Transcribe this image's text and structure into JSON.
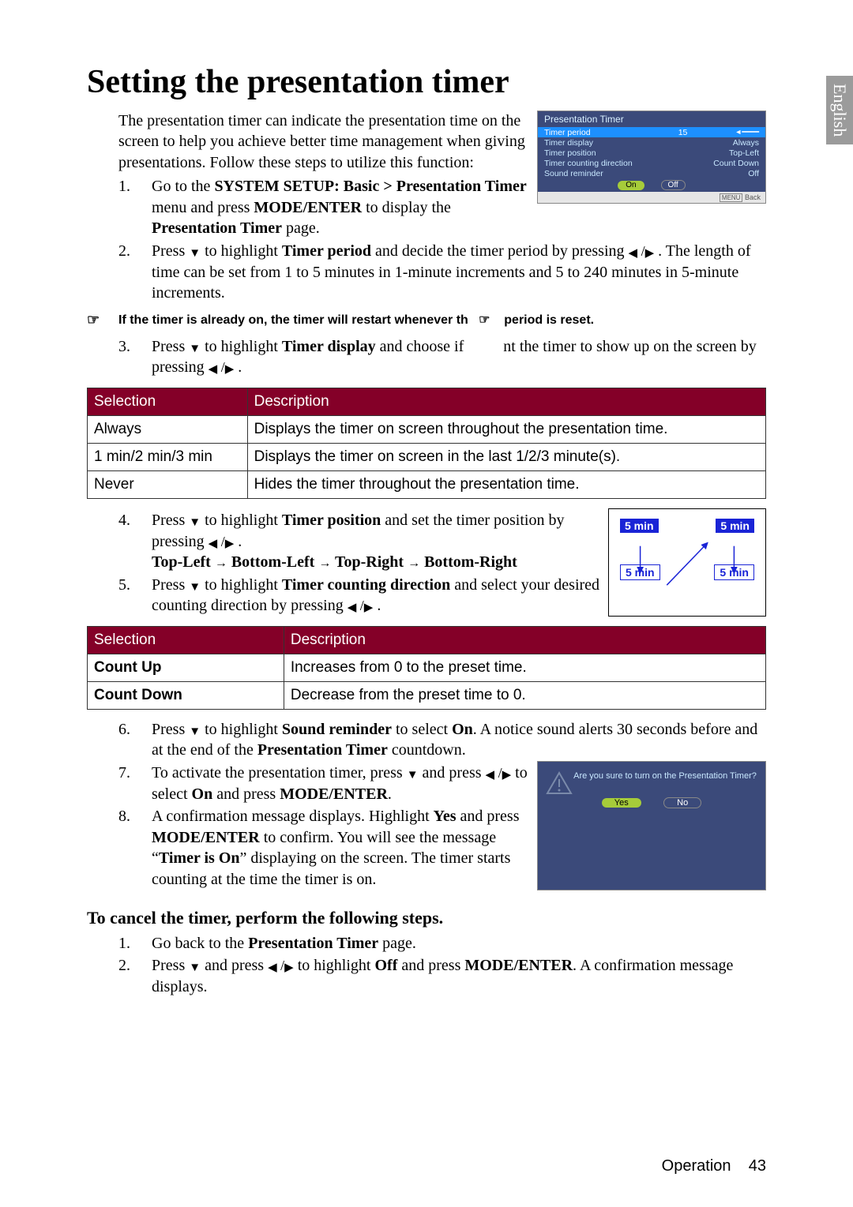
{
  "language_tab": "English",
  "title": "Setting the presentation timer",
  "intro": "The presentation timer can indicate the presentation time on the screen to help you achieve better time management when giving presentations. Follow these steps to utilize this function:",
  "osd": {
    "title": "Presentation Timer",
    "rows": [
      {
        "label": "Timer period",
        "value": "15"
      },
      {
        "label": "Timer display",
        "value": "Always"
      },
      {
        "label": "Timer position",
        "value": "Top-Left"
      },
      {
        "label": "Timer counting direction",
        "value": "Count Down"
      },
      {
        "label": "Sound reminder",
        "value": "Off"
      }
    ],
    "on": "On",
    "off": "Off",
    "menu": "MENU",
    "back": "Back"
  },
  "step1_a": "Go to the ",
  "step1_b": "SYSTEM SETUP: Basic > Presentation Timer",
  "step1_c": " menu and press ",
  "step1_d": "MODE/ENTER",
  "step1_e": " to display the ",
  "step1_f": "Presentation Timer",
  "step1_g": " page.",
  "step2_a": "Press ",
  "step2_b": " to highlight ",
  "step2_c": "Timer period",
  "step2_d": " and decide the timer period by pressing ",
  "step2_e": " . The length of time can be set from 1 to 5 minutes in 1-minute increments and 5 to 240 minutes in 5-minute increments.",
  "note1": "If the timer is already on, the timer will restart whenever th",
  "note1b": "period is reset.",
  "step3_a": "Press ",
  "step3_b": " to highlight ",
  "step3_c": "Timer display",
  "step3_d": " and choose if",
  "step3_e": "nt the timer to show up on the screen by pressing ",
  "table1": {
    "head1": "Selection",
    "head2": "Description",
    "rows": [
      [
        "Always",
        "Displays the timer on screen throughout the presentation time."
      ],
      [
        "1 min/2 min/3 min",
        "Displays the timer on screen in the last 1/2/3 minute(s)."
      ],
      [
        "Never",
        "Hides the timer throughout the presentation time."
      ]
    ]
  },
  "step4_a": "Press ",
  "step4_b": " to highlight ",
  "step4_c": "Timer position",
  "step4_d": " and set the timer position by pressing ",
  "step4_seq_a": "Top-Left",
  "step4_seq_b": "Bottom-Left",
  "step4_seq_c": "Top-Right",
  "step4_seq_d": "Bottom-Right",
  "pos_label": "5 min",
  "step5_a": "Press ",
  "step5_b": " to highlight ",
  "step5_c": "Timer counting direction",
  "step5_d": " and select your desired counting direction by pressing",
  "table2": {
    "head1": "Selection",
    "head2": "Description",
    "rows": [
      [
        "Count Up",
        "Increases from 0 to the preset time."
      ],
      [
        "Count Down",
        "Decrease from the preset time to 0."
      ]
    ]
  },
  "step6_a": "Press ",
  "step6_b": " to highlight ",
  "step6_c": "Sound reminder",
  "step6_d": " to select ",
  "step6_e": "On",
  "step6_f": ". A notice sound alerts 30 seconds before and at the end of the ",
  "step6_g": "Presentation Timer",
  "step6_h": " countdown.",
  "step7_a": "To activate the presentation timer, press ",
  "step7_b": " and press ",
  "step7_c": " to select ",
  "step7_d": "On",
  "step7_e": " and press ",
  "step7_f": "MODE/ENTER",
  "step7_g": ".",
  "step8_a": "A confirmation message displays. Highlight ",
  "step8_b": "Yes",
  "step8_c": " and press ",
  "step8_d": "MODE/ENTER",
  "step8_e": " to confirm. You will see the message “",
  "step8_f": "Timer is On",
  "step8_g": "” displaying on the screen. The timer starts counting at the time the timer is on.",
  "confirm": {
    "msg": "Are you sure to turn on the Presentation Timer?",
    "yes": "Yes",
    "no": "No"
  },
  "cancel_heading": "To cancel the timer, perform the following steps.",
  "cstep1_a": "Go back to the ",
  "cstep1_b": "Presentation Timer",
  "cstep1_c": " page.",
  "cstep2_a": "Press ",
  "cstep2_b": " and press ",
  "cstep2_c": " to highlight ",
  "cstep2_d": "Off",
  "cstep2_e": " and press ",
  "cstep2_f": "MODE/ENTER",
  "cstep2_g": ". A confirmation message displays.",
  "footer_label": "Operation",
  "footer_page": "43"
}
